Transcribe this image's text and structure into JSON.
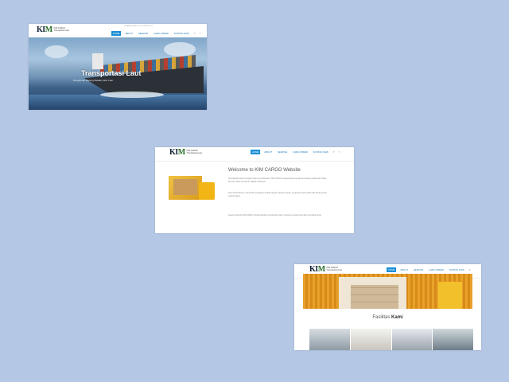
{
  "background_color": "#b4c7e4",
  "shot1": {
    "topbar": "info@kimcargo.com  |  +62 21 xxxx",
    "logo": {
      "mark_k": "K",
      "mark_i": "I",
      "mark_m": "M",
      "sub1": "KIM CARGO",
      "sub2": "Transportasi Laut"
    },
    "menu": [
      "HOME",
      "ABOUT",
      "SERVICE",
      "CARA ORDER",
      "KONTAK KAMI"
    ],
    "hero_title": "Transportasi Laut",
    "hero_subtitle": "Pengiriman Barang Melalui Jalur Laut"
  },
  "shot2": {
    "logo": {
      "mark_k": "K",
      "mark_i": "I",
      "mark_m": "M",
      "sub1": "KIM CARGO",
      "sub2": "Transportasi Laut"
    },
    "menu": [
      "HOME",
      "ABOUT",
      "SERVICE",
      "CARA ORDER",
      "KONTAK KAMI"
    ],
    "welcome": "Welcome to KIM CARGO Website",
    "para1": "Terimakasih atas kunjungan anda di website kami. KIM CARGO melayani jasa pengiriman barang melalui jalur darat, laut dan udara ke seluruh wilayah Indonesia.",
    "para2": "Kami berkomitmen memberikan pelayanan terbaik dengan harga bersaing, pengiriman tepat waktu dan barang aman sampai tujuan.",
    "para3": "Segera hubungi KIM CARGO untuk kebutuhan pengiriman anda. Customer service kami siap membantu anda."
  },
  "shot3": {
    "logo": {
      "mark_k": "K",
      "mark_i": "I",
      "mark_m": "M",
      "sub1": "KIM CARGO",
      "sub2": "Transportasi Laut"
    },
    "menu": [
      "HOME",
      "ABOUT",
      "SERVICE",
      "CARA ORDER",
      "KONTAK KAMI"
    ],
    "fasilitas_prefix": "Fasilitas",
    "fasilitas_bold": "Kami"
  }
}
